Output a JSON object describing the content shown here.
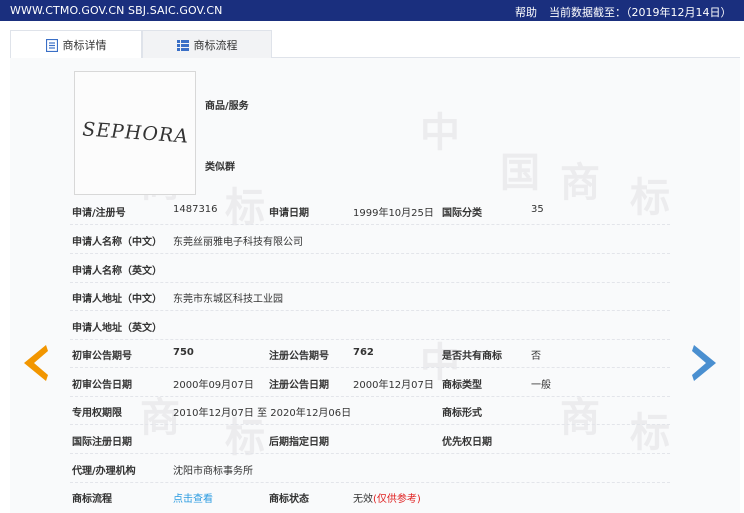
{
  "topbar": {
    "site": "WWW.CTMO.GOV.CN SBJ.SAIC.GOV.CN",
    "help": "帮助",
    "date_label": "当前数据截至：（2019年12月14日）"
  },
  "tabs": [
    {
      "label": "商标详情",
      "icon": "list-icon",
      "active": true
    },
    {
      "label": "商标流程",
      "icon": "process-icon",
      "active": false
    }
  ],
  "watermark": [
    "中",
    "国",
    "商",
    "标"
  ],
  "trademark": {
    "logo_text": "SEPHORA",
    "goods_label": "商品/服务",
    "similar_label": "类似群"
  },
  "rows": {
    "app_no_label": "申请/注册号",
    "app_no": "1487316",
    "app_date_label": "申请日期",
    "app_date": "1999年10月25日",
    "intl_class_label": "国际分类",
    "intl_class": "35",
    "applicant_cn_label": "申请人名称（中文）",
    "applicant_cn": "东莞丝丽雅电子科技有限公司",
    "applicant_en_label": "申请人名称（英文）",
    "address_cn_label": "申请人地址（中文）",
    "address_cn": "东莞市东城区科技工业园",
    "address_en_label": "申请人地址（英文）",
    "prelim_no_label": "初审公告期号",
    "prelim_no": "750",
    "reg_no_label": "注册公告期号",
    "reg_no": "762",
    "shared_label": "是否共有商标",
    "shared": "否",
    "prelim_date_label": "初审公告日期",
    "prelim_date": "2000年09月07日",
    "reg_date_label": "注册公告日期",
    "reg_date": "2000年12月07日",
    "type_label": "商标类型",
    "type": "一般",
    "period_label": "专用权期限",
    "period": "2010年12月07日 至 2020年12月06日",
    "form_label": "商标形式",
    "intl_reg_label": "国际注册日期",
    "later_label": "后期指定日期",
    "priority_label": "优先权日期",
    "agent_label": "代理/办理机构",
    "agent": "沈阳市商标事务所",
    "flow_label": "商标流程",
    "flow_link": "点击查看",
    "status_label": "商标状态",
    "status": "无效",
    "status_note": "(仅供参考)"
  },
  "colors": {
    "topbar": "#1a2f7e",
    "arrow_left": "#f29600",
    "arrow_right": "#4a8fd0",
    "link": "#2a9be0",
    "note": "#e02020"
  }
}
